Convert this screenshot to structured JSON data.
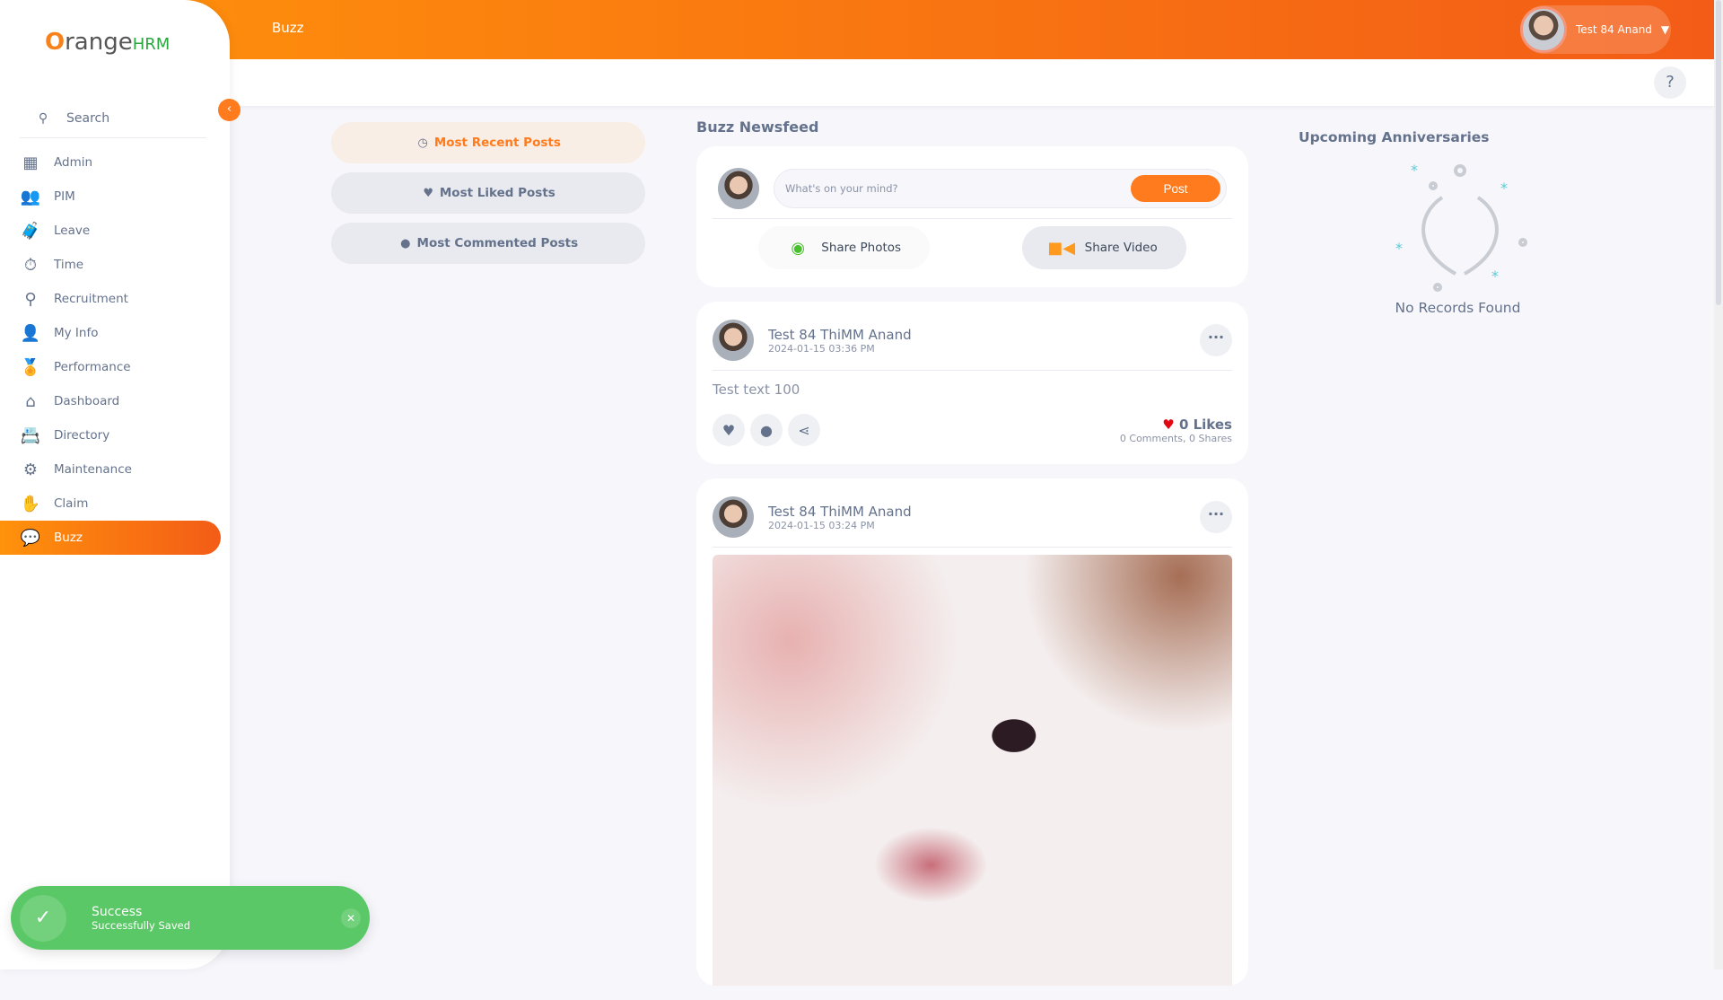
{
  "header": {
    "breadcrumb": "Buzz",
    "user_name": "Test 84 Anand",
    "help": "?"
  },
  "brand": {
    "logo_text": "OrangeHRM",
    "accent": "#ff7b1d",
    "success": "#5bc867"
  },
  "sidebar": {
    "search_placeholder": "Search",
    "items": [
      {
        "label": "Admin",
        "icon": "admin-icon",
        "glyph": "▦"
      },
      {
        "label": "PIM",
        "icon": "pim-icon",
        "glyph": "👥"
      },
      {
        "label": "Leave",
        "icon": "leave-icon",
        "glyph": "🧳"
      },
      {
        "label": "Time",
        "icon": "time-icon",
        "glyph": "⏱"
      },
      {
        "label": "Recruitment",
        "icon": "recruitment-icon",
        "glyph": "⚲"
      },
      {
        "label": "My Info",
        "icon": "my-info-icon",
        "glyph": "👤"
      },
      {
        "label": "Performance",
        "icon": "performance-icon",
        "glyph": "🏅"
      },
      {
        "label": "Dashboard",
        "icon": "dashboard-icon",
        "glyph": "⌂"
      },
      {
        "label": "Directory",
        "icon": "directory-icon",
        "glyph": "📇"
      },
      {
        "label": "Maintenance",
        "icon": "maintenance-icon",
        "glyph": "⚙"
      },
      {
        "label": "Claim",
        "icon": "claim-icon",
        "glyph": "✋"
      },
      {
        "label": "Buzz",
        "icon": "buzz-icon",
        "glyph": "💬",
        "active": true
      }
    ]
  },
  "filters": [
    {
      "label": "Most Recent Posts",
      "glyph": "◷",
      "selected": true
    },
    {
      "label": "Most Liked Posts",
      "glyph": "♥"
    },
    {
      "label": "Most Commented Posts",
      "glyph": "●"
    }
  ],
  "newsfeed": {
    "title": "Buzz Newsfeed",
    "placeholder": "What's on your mind?",
    "post_label": "Post",
    "share_photos": "Share Photos",
    "share_video": "Share Video",
    "posts": [
      {
        "author": "Test 84 ThiMM Anand",
        "date": "2024-01-15 03:36 PM",
        "text": "Test text 100",
        "likes": "0 Likes",
        "comments": "0 Comments",
        "shares": "0 Shares"
      },
      {
        "author": "Test 84 ThiMM Anand",
        "date": "2024-01-15 03:24 PM",
        "has_image": true
      }
    ]
  },
  "anniversaries": {
    "title": "Upcoming Anniversaries",
    "empty": "No Records Found"
  },
  "toast": {
    "title": "Success",
    "message": "Successfully Saved"
  }
}
